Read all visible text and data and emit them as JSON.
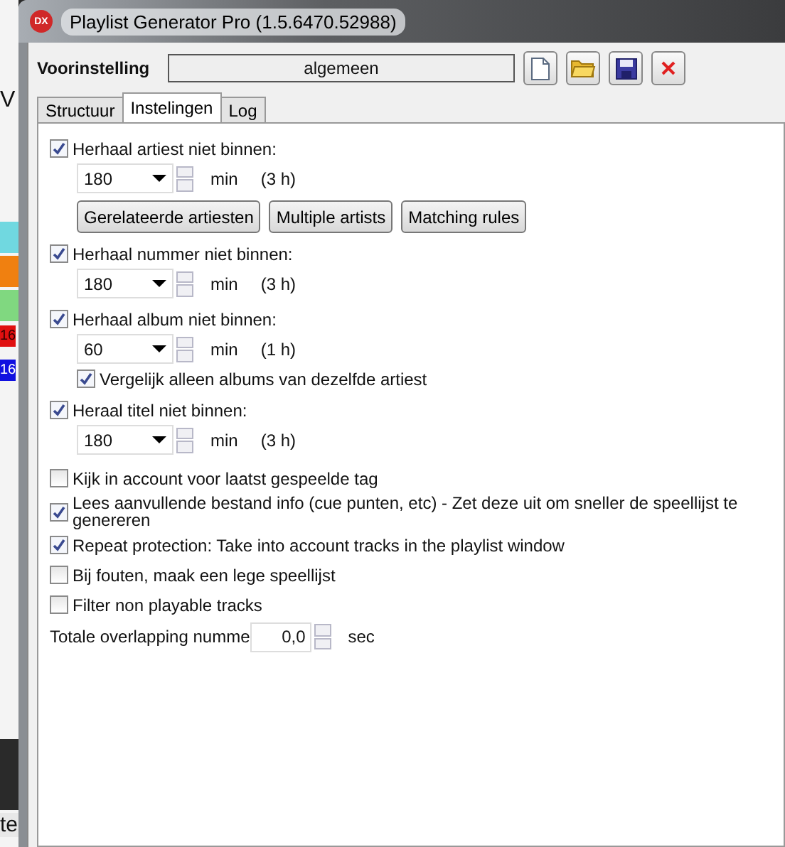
{
  "background_app": {
    "texts": [
      "V",
      "16",
      "16",
      "te"
    ]
  },
  "window": {
    "title": "Playlist Generator Pro (1.5.6470.52988)",
    "app_icon_text": "DX"
  },
  "preset": {
    "label": "Voorinstelling",
    "value": "algemeen"
  },
  "toolbar": [
    {
      "kind": "new"
    },
    {
      "kind": "open"
    },
    {
      "kind": "save"
    },
    {
      "kind": "delete"
    }
  ],
  "tabs": [
    {
      "label": "Structuur",
      "selected": false
    },
    {
      "label": "Instelingen",
      "selected": true
    },
    {
      "label": "Log",
      "selected": false
    }
  ],
  "repeat_rules": [
    {
      "label": "Herhaal artiest niet binnen:",
      "checked": true,
      "value": "180",
      "unit": "min",
      "hours": "(3 h)",
      "buttons": [
        "Gerelateerde artiesten",
        "Multiple artists",
        "Matching rules"
      ]
    },
    {
      "label": "Herhaal nummer niet binnen:",
      "checked": true,
      "value": "180",
      "unit": "min",
      "hours": "(3 h)"
    },
    {
      "label": "Herhaal album niet binnen:",
      "checked": true,
      "value": "60",
      "unit": "min",
      "hours": "(1 h)",
      "sub_option": {
        "label": "Vergelijk alleen albums van dezelfde artiest",
        "checked": true
      }
    },
    {
      "label": "Heraal titel niet binnen:",
      "checked": true,
      "value": "180",
      "unit": "min",
      "hours": "(3 h)"
    }
  ],
  "options": [
    {
      "label": "Kijk in account voor laatst gespeelde tag",
      "checked": false
    },
    {
      "label": "Lees aanvullende bestand info (cue punten, etc) - Zet deze uit om sneller de speellijst te genereren",
      "checked": true
    },
    {
      "label": "Repeat protection: Take into account tracks in the playlist window",
      "checked": true
    },
    {
      "label": "Bij fouten, maak een lege speellijst",
      "checked": false
    },
    {
      "label": "Filter non playable tracks",
      "checked": false
    }
  ],
  "overlap": {
    "label": "Totale overlapping numme",
    "value": "0,0",
    "unit": "sec"
  }
}
